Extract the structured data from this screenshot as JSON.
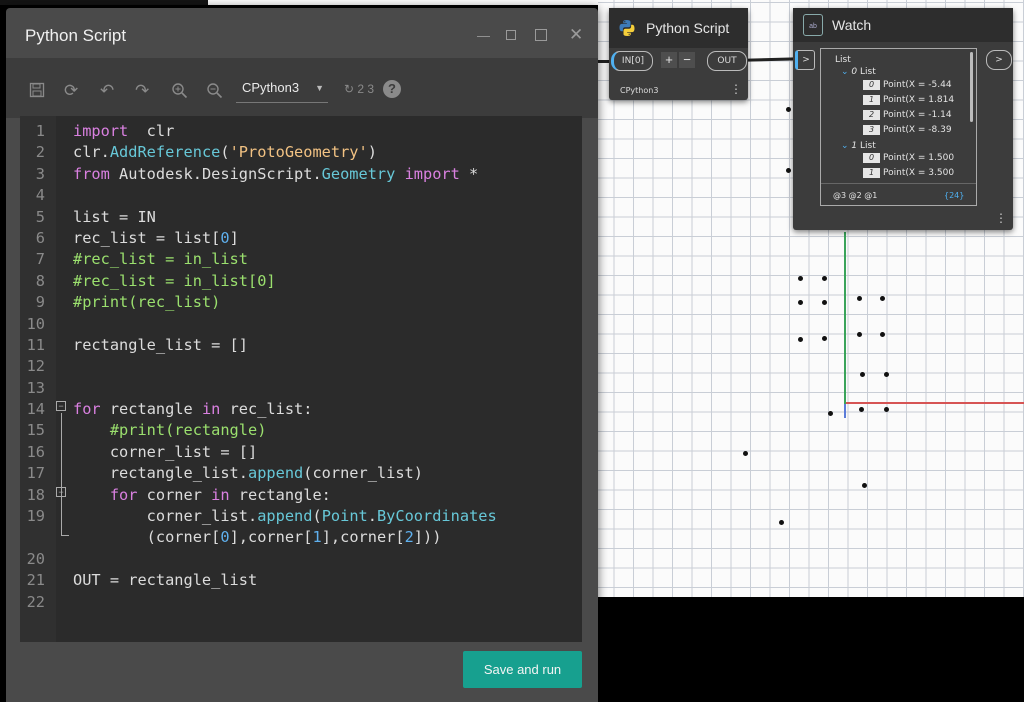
{
  "dialog": {
    "title": "Python Script",
    "engine": "CPython3",
    "run_label": "Save and run",
    "code_lines": [
      {
        "n": "1",
        "parts": [
          [
            "kw",
            "import"
          ],
          [
            "",
            "  clr"
          ]
        ]
      },
      {
        "n": "2",
        "parts": [
          [
            "",
            "clr."
          ],
          [
            "fn",
            "AddReference"
          ],
          [
            "",
            "("
          ],
          [
            "st",
            "'ProtoGeometry'"
          ],
          [
            "",
            ")"
          ]
        ]
      },
      {
        "n": "3",
        "parts": [
          [
            "kw",
            "from"
          ],
          [
            "",
            " Autodesk.DesignScript."
          ],
          [
            "fn",
            "Geometry"
          ],
          [
            "",
            ""
          ],
          [
            "kw",
            " import"
          ],
          [
            "",
            " *"
          ]
        ]
      },
      {
        "n": "4",
        "parts": []
      },
      {
        "n": "5",
        "parts": [
          [
            "",
            "list = IN"
          ]
        ]
      },
      {
        "n": "6",
        "parts": [
          [
            "",
            "rec_list = list["
          ],
          [
            "nm",
            "0"
          ],
          [
            "",
            "]"
          ]
        ]
      },
      {
        "n": "7",
        "parts": [
          [
            "cm",
            "#rec_list = in_list"
          ]
        ]
      },
      {
        "n": "8",
        "parts": [
          [
            "cm",
            "#rec_list = in_list[0]"
          ]
        ]
      },
      {
        "n": "9",
        "parts": [
          [
            "cm",
            "#print(rec_list)"
          ]
        ]
      },
      {
        "n": "10",
        "parts": []
      },
      {
        "n": "11",
        "parts": [
          [
            "",
            "rectangle_list = []"
          ]
        ]
      },
      {
        "n": "12",
        "parts": []
      },
      {
        "n": "13",
        "parts": []
      },
      {
        "n": "14",
        "parts": [
          [
            "kw",
            "for"
          ],
          [
            "",
            " rectangle "
          ],
          [
            "kw",
            "in"
          ],
          [
            "",
            " rec_list:"
          ]
        ]
      },
      {
        "n": "15",
        "parts": [
          [
            "cm",
            "    #print(rectangle)"
          ]
        ]
      },
      {
        "n": "16",
        "parts": [
          [
            "",
            "    corner_list = []"
          ]
        ]
      },
      {
        "n": "17",
        "parts": [
          [
            "",
            "    rectangle_list."
          ],
          [
            "fn",
            "append"
          ],
          [
            "",
            "(corner_list)"
          ]
        ]
      },
      {
        "n": "18",
        "parts": [
          [
            "kw",
            "    for"
          ],
          [
            "",
            " corner "
          ],
          [
            "kw",
            "in"
          ],
          [
            "",
            " rectangle:"
          ]
        ]
      },
      {
        "n": "19",
        "parts": [
          [
            "",
            "        corner_list."
          ],
          [
            "fn",
            "append"
          ],
          [
            "",
            "("
          ],
          [
            "fn",
            "Point"
          ],
          [
            "",
            "."
          ],
          [
            "fn",
            "ByCoordinates"
          ]
        ]
      },
      {
        "n": "",
        "parts": [
          [
            "",
            "        (corner["
          ],
          [
            "nm",
            "0"
          ],
          [
            "",
            "],corner["
          ],
          [
            "nm",
            "1"
          ],
          [
            "",
            "],corner["
          ],
          [
            "nm",
            "2"
          ],
          [
            "",
            "]))"
          ]
        ]
      },
      {
        "n": "20",
        "parts": []
      },
      {
        "n": "21",
        "parts": [
          [
            "",
            "OUT = rectangle_list"
          ]
        ]
      },
      {
        "n": "22",
        "parts": []
      }
    ]
  },
  "python_node": {
    "title": "Python Script",
    "input_port": "IN[0]",
    "add_label": "+",
    "remove_label": "−",
    "output_port": "OUT",
    "engine_label": "CPython3",
    "menu_label": "⋮"
  },
  "watch_node": {
    "title": "Watch",
    "in_port": ">",
    "out_port": ">",
    "root_label": "List",
    "sub0_index": "0",
    "sub0_label": "List",
    "sub0_items": [
      {
        "i": "0",
        "v": "Point(X = -5.44"
      },
      {
        "i": "1",
        "v": "Point(X = 1.814"
      },
      {
        "i": "2",
        "v": "Point(X = -1.14"
      },
      {
        "i": "3",
        "v": "Point(X = -8.39"
      }
    ],
    "sub1_index": "1",
    "sub1_label": "List",
    "sub1_items": [
      {
        "i": "0",
        "v": "Point(X = 1.500"
      },
      {
        "i": "1",
        "v": "Point(X = 3.500"
      }
    ],
    "levels": "@3 @2 @1",
    "count": "{24}",
    "menu_label": "⋮"
  },
  "colors": {
    "accent": "#17a08f",
    "canvas": "#fbfbfb",
    "node": "#3c3c3c"
  }
}
